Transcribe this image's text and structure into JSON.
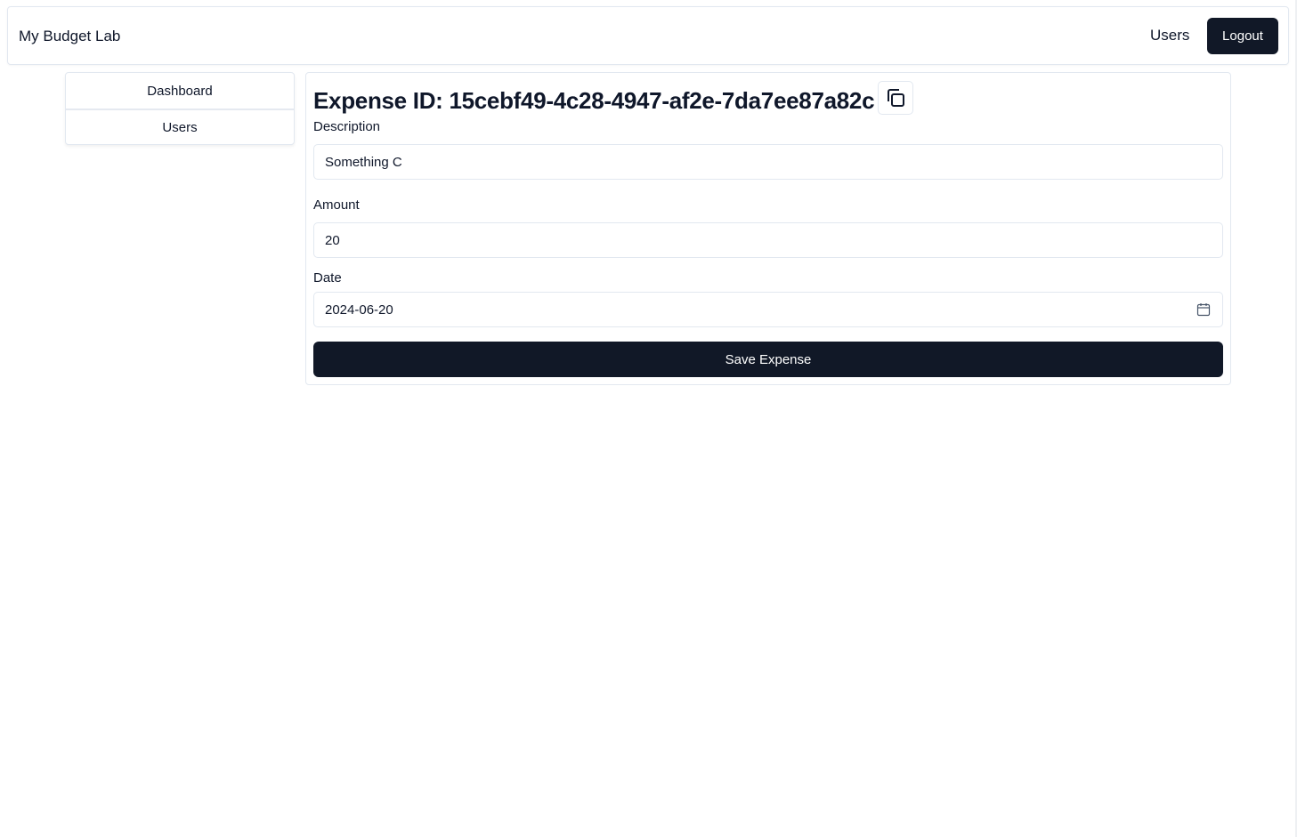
{
  "header": {
    "brand": "My Budget Lab",
    "users_link": "Users",
    "logout_label": "Logout"
  },
  "sidebar": {
    "items": [
      {
        "label": "Dashboard"
      },
      {
        "label": "Users"
      }
    ]
  },
  "form": {
    "title": "Expense ID: 15cebf49-4c28-4947-af2e-7da7ee87a82c",
    "copy_icon": "copy-icon",
    "description_label": "Description",
    "description_value": "Something C",
    "amount_label": "Amount",
    "amount_value": "20",
    "date_label": "Date",
    "date_value": "2024-06-20",
    "calendar_icon": "calendar-icon",
    "save_label": "Save Expense"
  },
  "colors": {
    "primary_button": "#111827",
    "border": "#e2e8f0",
    "text": "#0f172a"
  }
}
